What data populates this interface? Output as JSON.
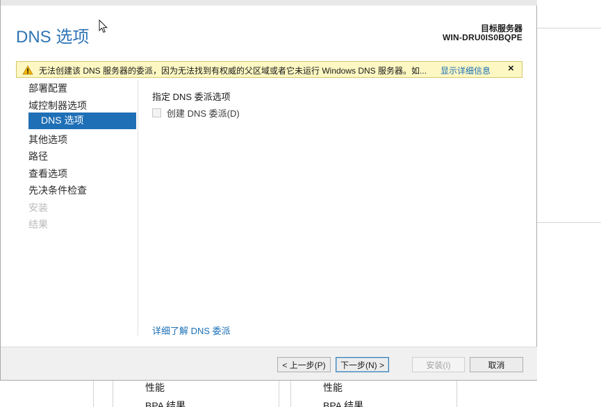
{
  "background": {
    "tiles": [
      {
        "row1": "性能",
        "row2": "BPA 结果"
      },
      {
        "row1": "性能",
        "row2": "BPA 结果"
      }
    ]
  },
  "header": {
    "title": "DNS 选项",
    "target_label": "目标服务器",
    "target_name": "WIN-DRU0IS0BQPE"
  },
  "warning": {
    "icon": "warning-icon",
    "text": "无法创建该 DNS 服务器的委派，因为无法找到有权威的父区域或者它未运行 Windows DNS 服务器。如...",
    "link": "显示详细信息",
    "close": "×"
  },
  "nav": {
    "items": [
      {
        "label": "部署配置",
        "state": "normal"
      },
      {
        "label": "域控制器选项",
        "state": "normal"
      },
      {
        "label": "DNS 选项",
        "state": "selected"
      },
      {
        "label": "其他选项",
        "state": "normal"
      },
      {
        "label": "路径",
        "state": "normal"
      },
      {
        "label": "查看选项",
        "state": "normal"
      },
      {
        "label": "先决条件检查",
        "state": "normal"
      },
      {
        "label": "安装",
        "state": "disabled"
      },
      {
        "label": "结果",
        "state": "disabled"
      }
    ]
  },
  "content": {
    "section_label": "指定 DNS 委派选项",
    "checkbox_label": "创建 DNS 委派(D)",
    "checkbox_checked": false,
    "learn_more": "详细了解 DNS 委派"
  },
  "footer": {
    "prev": "< 上一步(P)",
    "next": "下一步(N) >",
    "install": "安装(I)",
    "cancel": "取消"
  },
  "colors": {
    "accent": "#1f6fb6",
    "title": "#2e74b5",
    "link": "#1a6fb5",
    "warning_bg": "#fdf7c3"
  }
}
